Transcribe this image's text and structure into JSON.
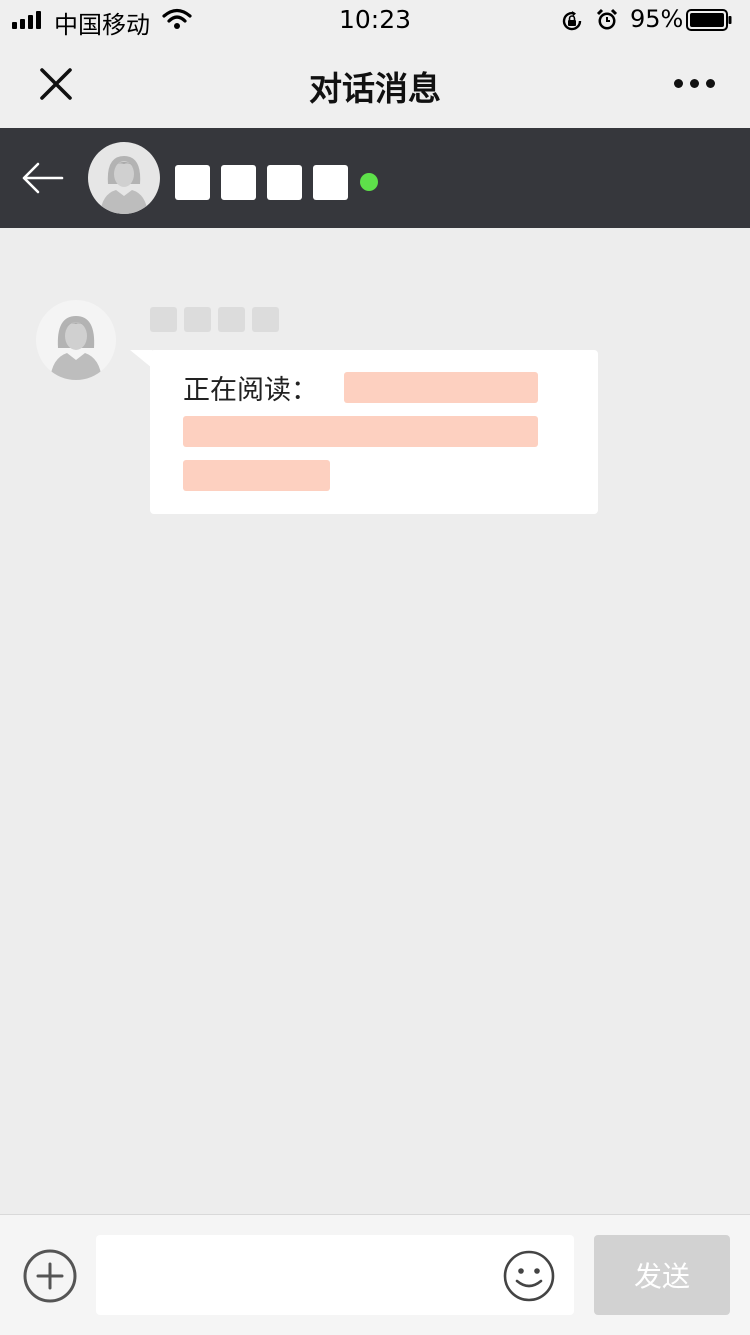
{
  "status_bar": {
    "carrier": "中国移动",
    "time": "10:23",
    "battery": "95%",
    "battery_level": 0.95,
    "icons": [
      "signal-icon",
      "wifi-icon",
      "orientation-lock-icon",
      "alarm-icon",
      "battery-icon"
    ]
  },
  "nav": {
    "title": "对话消息",
    "close_icon": "close-icon",
    "more_icon": "more-icon"
  },
  "chat_header": {
    "back_icon": "arrow-left-icon",
    "avatar_icon": "default-female-avatar",
    "online_color": "#5ee04a"
  },
  "message": {
    "avatar_icon": "default-female-avatar",
    "text_prefix": "正在阅读："
  },
  "input_bar": {
    "placeholder": "",
    "send_label": "发送",
    "plus_icon": "plus-circle-icon",
    "emoji_icon": "smiley-icon"
  },
  "colors": {
    "header_bg": "#36373c",
    "page_bg": "#ededed",
    "redaction": "#fdd0c0",
    "send_disabled": "#d2d2d2"
  }
}
